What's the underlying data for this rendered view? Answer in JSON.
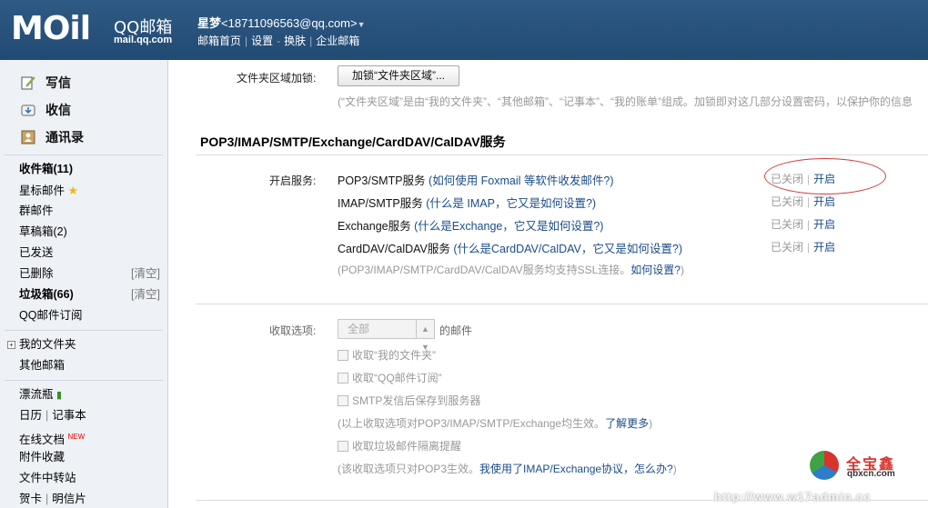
{
  "header": {
    "logo_text": "MOil",
    "brand": "QQ邮箱",
    "url": "mail.qq.com",
    "user_name": "星梦",
    "user_email": "<18711096563@qq.com>",
    "links": [
      "邮箱首页",
      "设置",
      "换肤",
      "企业邮箱"
    ],
    "link_seps": [
      "|",
      "-",
      "|"
    ]
  },
  "sidebar": {
    "quick": [
      {
        "label": "写信",
        "icon": "write-icon"
      },
      {
        "label": "收信",
        "icon": "receive-icon"
      },
      {
        "label": "通讯录",
        "icon": "contacts-icon"
      }
    ],
    "folders": [
      {
        "label": "收件箱(11)"
      },
      {
        "label": "星标邮件"
      },
      {
        "label": "群邮件"
      },
      {
        "label": "草稿箱(2)"
      },
      {
        "label": "已发送"
      },
      {
        "label": "已删除",
        "clear": "[清空]"
      },
      {
        "label": "垃圾箱(66)",
        "clear": "[清空]"
      },
      {
        "label": "QQ邮件订阅"
      }
    ],
    "groups": [
      {
        "label": "我的文件夹"
      },
      {
        "label": "其他邮箱"
      }
    ],
    "apps": {
      "bottle": "漂流瓶",
      "calendar": "日历",
      "notes": "记事本",
      "online_docs": "在线文档",
      "new_badge": "NEW",
      "attachments": "附件收藏",
      "transfer": "文件中转站",
      "cards": "贺卡",
      "postcards": "明信片"
    }
  },
  "main": {
    "lock_label": "文件夹区域加锁:",
    "lock_button": "加锁“文件夹区域”...",
    "lock_note": "(“文件夹区域”是由“我的文件夹”、“其他邮箱”、“记事本”、“我的账单”组成。加锁即对这几部分设置密码，以保护你的信息",
    "section_title": "POP3/IMAP/SMTP/Exchange/CardDAV/CalDAV服务",
    "enable_label": "开启服务:",
    "services": [
      {
        "name": "POP3/SMTP服务",
        "hint": "(如何使用 Foxmail 等软件收发邮件?)",
        "off": "已关闭",
        "sep": "|",
        "on": "开启"
      },
      {
        "name": "IMAP/SMTP服务",
        "hint": "(什么是 IMAP，它又是如何设置?)",
        "off": "已关闭",
        "sep": "|",
        "on": "开启"
      },
      {
        "name": "Exchange服务",
        "hint": "(什么是Exchange，它又是如何设置?)",
        "off": "已关闭",
        "sep": "|",
        "on": "开启"
      },
      {
        "name": "CardDAV/CalDAV服务",
        "hint": "(什么是CardDAV/CalDAV，它又是如何设置?)",
        "off": "已关闭",
        "sep": "|",
        "on": "开启"
      }
    ],
    "ssl_note": "(POP3/IMAP/SMTP/CardDAV/CalDAV服务均支持SSL连接。",
    "ssl_link": "如何设置?",
    "ssl_close": ")",
    "receive_label": "收取选项:",
    "receive_select": "全部",
    "receive_suffix": "的邮件",
    "options": [
      "收取“我的文件夹”",
      "收取“QQ邮件订阅”",
      "SMTP发信后保存到服务器"
    ],
    "options_note": "(以上收取选项对POP3/IMAP/SMTP/Exchange均生效。",
    "options_link": "了解更多",
    "options_close": ")",
    "spam_option": "收取垃圾邮件隔离提醒",
    "spam_note": "(该收取选项只对POP3生效。",
    "spam_link": "我使用了IMAP/Exchange协议，怎么办?",
    "spam_close": ")"
  },
  "watermark": {
    "brand": "全宝鑫",
    "url": "qbxcn.com",
    "bottom": "http://www.w17admin.cc"
  },
  "colors": {
    "header": "#2a5481",
    "sidebar": "#eef2f6",
    "link": "#1a4c8a",
    "annotation": "#d23b3b"
  }
}
